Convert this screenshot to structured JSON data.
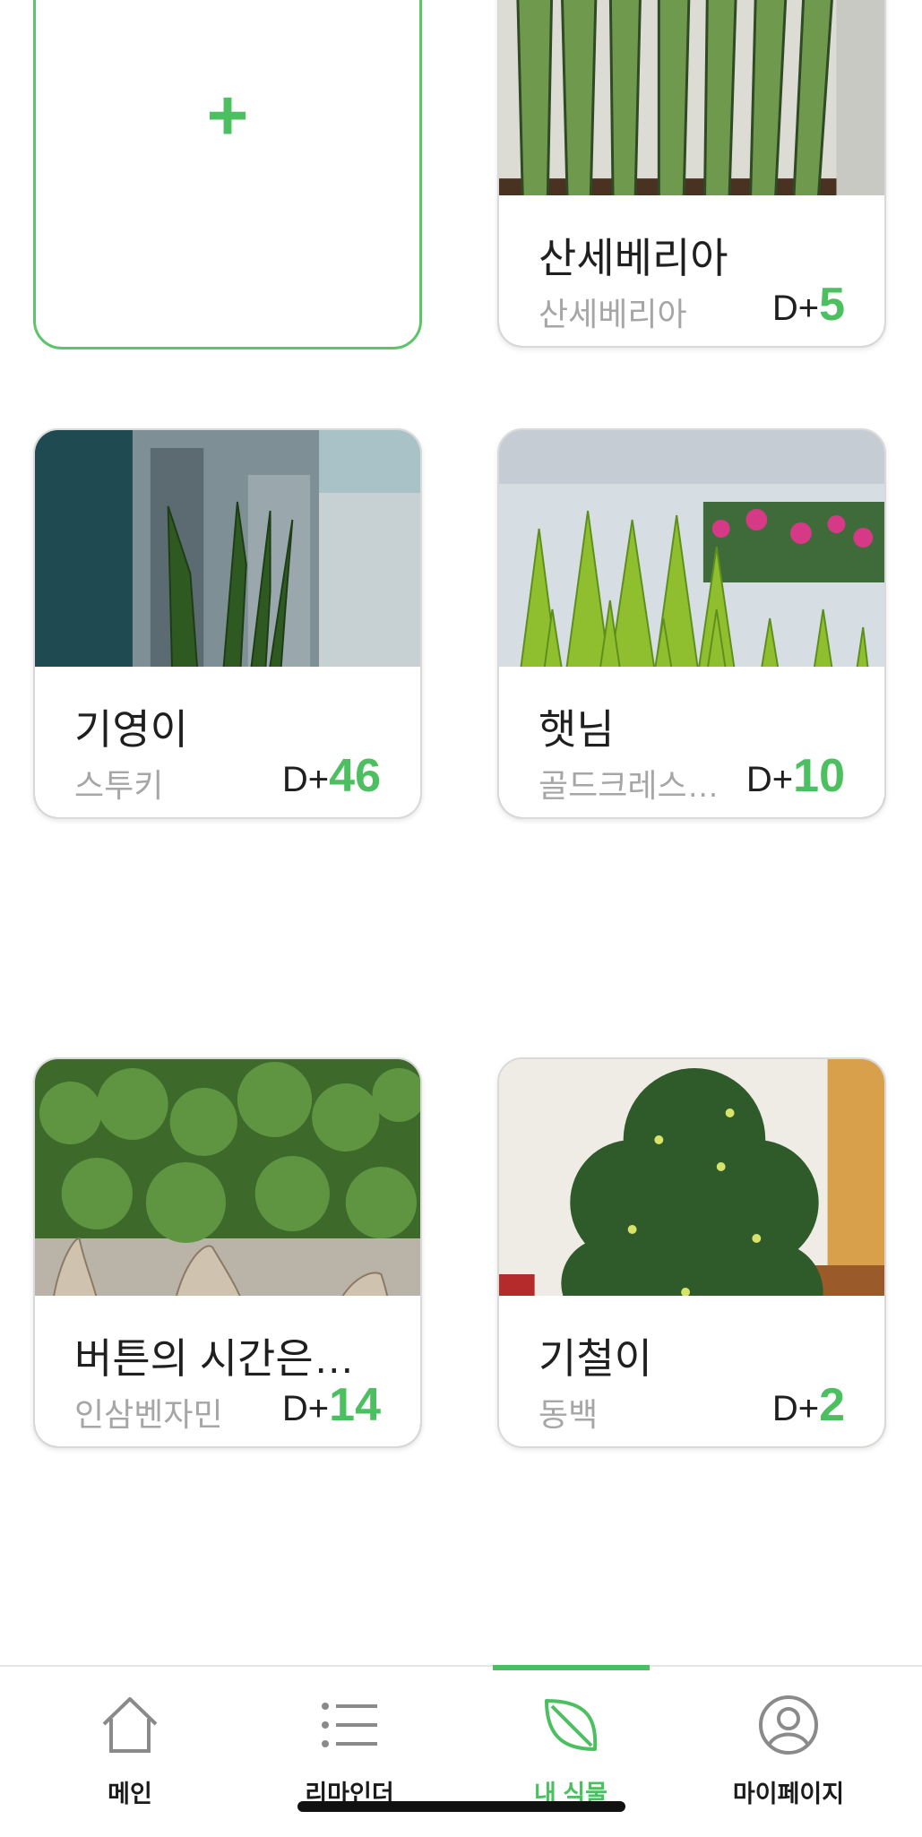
{
  "add_card": {
    "label": "+"
  },
  "plants": [
    {
      "name": "산세베리아",
      "species": "산세베리아",
      "dday_prefix": "D+",
      "dday_value": "5",
      "photo": "snake-plant-photo"
    },
    {
      "name": "기영이",
      "species": "스투키",
      "dday_prefix": "D+",
      "dday_value": "46",
      "photo": "stuckyi-pot-photo"
    },
    {
      "name": "햇님",
      "species": "골드크레스…",
      "dday_prefix": "D+",
      "dday_value": "10",
      "photo": "goldcrest-photo"
    },
    {
      "name": "버튼의 시간은…",
      "species": "인삼벤자민",
      "dday_prefix": "D+",
      "dday_value": "14",
      "photo": "ginseng-ficus-photo"
    },
    {
      "name": "기철이",
      "species": "동백",
      "dday_prefix": "D+",
      "dday_value": "2",
      "photo": "camellia-photo"
    }
  ],
  "bottom_nav": {
    "active_index": 2,
    "items": [
      {
        "label": "메인",
        "icon": "home-icon"
      },
      {
        "label": "리마인더",
        "icon": "list-icon"
      },
      {
        "label": "내 식물",
        "icon": "leaf-icon"
      },
      {
        "label": "마이페이지",
        "icon": "profile-icon"
      }
    ]
  },
  "colors": {
    "accent": "#4cc060",
    "border": "#d9d9d9",
    "text": "#1f1f1f",
    "subtext": "#a6a6a6"
  }
}
